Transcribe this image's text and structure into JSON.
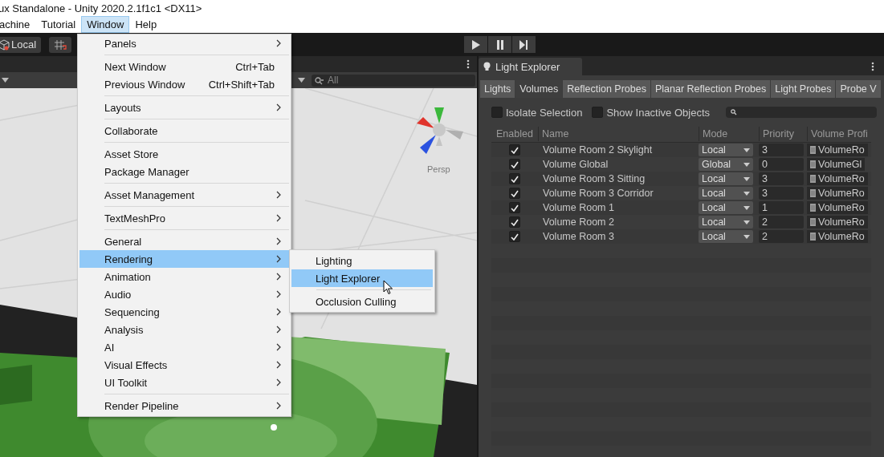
{
  "window": {
    "title": "ux Standalone - Unity 2020.2.1f1c1 <DX11>"
  },
  "menu_bar": [
    {
      "label": "achine",
      "selected": false
    },
    {
      "label": "Tutorial",
      "selected": false
    },
    {
      "label": "Window",
      "selected": true
    },
    {
      "label": "Help",
      "selected": false
    }
  ],
  "toolbar": {
    "pivot_button": "Local"
  },
  "scene_view": {
    "search": {
      "placeholder": "All"
    },
    "camera_label": "Persp"
  },
  "window_menu": {
    "groups": [
      [
        {
          "label": "Panels",
          "submenu": true,
          "selected": false
        }
      ],
      [
        {
          "label": "Next Window",
          "shortcut": "Ctrl+Tab",
          "submenu": false,
          "selected": false
        },
        {
          "label": "Previous Window",
          "shortcut": "Ctrl+Shift+Tab",
          "submenu": false,
          "selected": false
        }
      ],
      [
        {
          "label": "Layouts",
          "submenu": true,
          "selected": false
        }
      ],
      [
        {
          "label": "Collaborate",
          "submenu": false,
          "selected": false
        }
      ],
      [
        {
          "label": "Asset Store",
          "submenu": false,
          "selected": false
        },
        {
          "label": "Package Manager",
          "submenu": false,
          "selected": false
        }
      ],
      [
        {
          "label": "Asset Management",
          "submenu": true,
          "selected": false
        }
      ],
      [
        {
          "label": "TextMeshPro",
          "submenu": true,
          "selected": false
        }
      ],
      [
        {
          "label": "General",
          "submenu": true,
          "selected": false
        },
        {
          "label": "Rendering",
          "submenu": true,
          "selected": true
        },
        {
          "label": "Animation",
          "submenu": true,
          "selected": false
        },
        {
          "label": "Audio",
          "submenu": true,
          "selected": false
        },
        {
          "label": "Sequencing",
          "submenu": true,
          "selected": false
        },
        {
          "label": "Analysis",
          "submenu": true,
          "selected": false
        },
        {
          "label": "AI",
          "submenu": true,
          "selected": false
        },
        {
          "label": "Visual Effects",
          "submenu": true,
          "selected": false
        },
        {
          "label": "UI Toolkit",
          "submenu": true,
          "selected": false
        }
      ],
      [
        {
          "label": "Render Pipeline",
          "submenu": true,
          "selected": false
        }
      ]
    ]
  },
  "rendering_submenu": {
    "groups": [
      [
        {
          "label": "Lighting",
          "selected": false
        },
        {
          "label": "Light Explorer",
          "selected": true
        }
      ],
      [
        {
          "label": "Occlusion Culling",
          "selected": false
        }
      ]
    ]
  },
  "light_explorer": {
    "title": "Light Explorer",
    "tabs": [
      {
        "label": "Lights",
        "selected": false
      },
      {
        "label": "Volumes",
        "selected": true
      },
      {
        "label": "Reflection Probes",
        "selected": false
      },
      {
        "label": "Planar Reflection Probes",
        "selected": false
      },
      {
        "label": "Light Probes",
        "selected": false
      },
      {
        "label": "Probe V",
        "selected": false
      }
    ],
    "isolate_selection": {
      "label": "Isolate Selection",
      "checked": false
    },
    "show_inactive_objects": {
      "label": "Show Inactive Objects",
      "checked": false
    },
    "table": {
      "columns": [
        "Enabled",
        "Name",
        "Mode",
        "Priority",
        "Volume Profi"
      ],
      "rows": [
        {
          "enabled": true,
          "name": "Volume Room 2 Skylight",
          "mode": "Local",
          "priority": "3",
          "profile": "VolumeRo"
        },
        {
          "enabled": true,
          "name": "Volume Global",
          "mode": "Global",
          "priority": "0",
          "profile": "VolumeGl"
        },
        {
          "enabled": true,
          "name": "Volume Room 3 Sitting",
          "mode": "Local",
          "priority": "3",
          "profile": "VolumeRo"
        },
        {
          "enabled": true,
          "name": "Volume Room 3 Corridor",
          "mode": "Local",
          "priority": "3",
          "profile": "VolumeRo"
        },
        {
          "enabled": true,
          "name": "Volume Room 1",
          "mode": "Local",
          "priority": "1",
          "profile": "VolumeRo"
        },
        {
          "enabled": true,
          "name": "Volume Room 2",
          "mode": "Local",
          "priority": "2",
          "profile": "VolumeRo"
        },
        {
          "enabled": true,
          "name": "Volume Room 3",
          "mode": "Local",
          "priority": "2",
          "profile": "VolumeRo"
        }
      ]
    }
  }
}
